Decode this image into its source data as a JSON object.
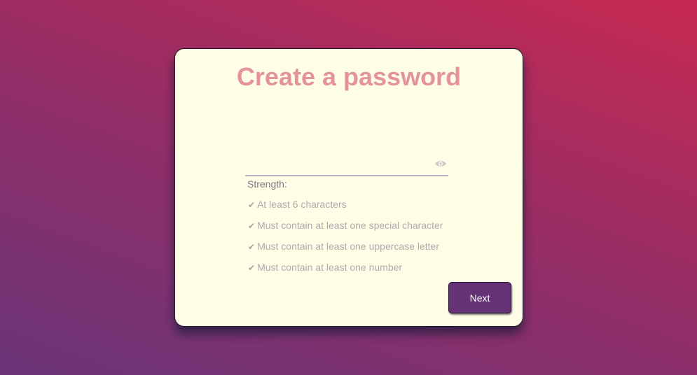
{
  "card": {
    "title": "Create a password"
  },
  "password_field": {
    "value": "",
    "placeholder": "",
    "toggle_icon": "eye-icon"
  },
  "strength": {
    "label": "Strength:"
  },
  "requirements": [
    {
      "check": "✔",
      "text": "At least 6 characters"
    },
    {
      "check": "✔",
      "text": "Must contain at least one special character"
    },
    {
      "check": "✔",
      "text": "Must contain at least one uppercase letter"
    },
    {
      "check": "✔",
      "text": "Must contain at least one number"
    }
  ],
  "next_button": {
    "label": "Next"
  },
  "colors": {
    "background_start": "#6a3578",
    "background_end": "#c72a52",
    "card": "#fefee6",
    "title": "#e4939b",
    "button": "#653276"
  }
}
